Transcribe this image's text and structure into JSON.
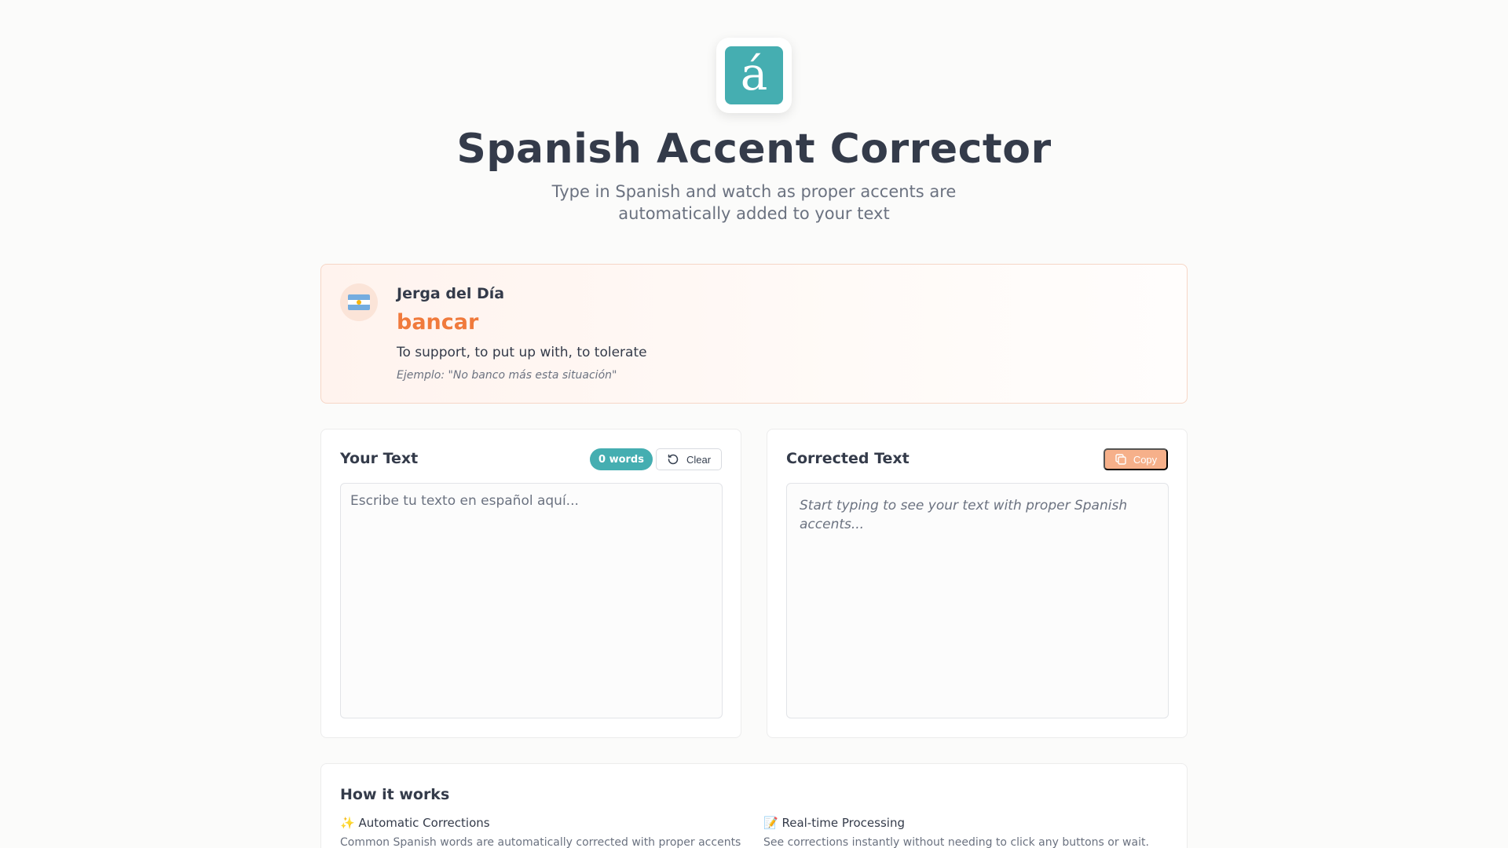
{
  "header": {
    "logo_letter": "á",
    "title": "Spanish Accent Corrector",
    "subtitle": "Type in Spanish and watch as proper accents are automatically added to your text"
  },
  "slang_card": {
    "flag_icon": "argentina-flag-icon",
    "label": "Jerga del Día",
    "word": "bancar",
    "definition": "To support, to put up with, to tolerate",
    "example": "Ejemplo: \"No banco más esta situación\""
  },
  "input_panel": {
    "title": "Your Text",
    "word_count": "0 words",
    "clear_label": "Clear",
    "value": "",
    "placeholder": "Escribe tu texto en español aquí..."
  },
  "output_panel": {
    "title": "Corrected Text",
    "copy_label": "Copy",
    "placeholder": "Start typing to see your text with proper Spanish accents..."
  },
  "how_it_works": {
    "title": "How it works",
    "items": [
      {
        "icon": "sparkles-icon",
        "emoji": "✨",
        "title": "Automatic Corrections",
        "description": "Common Spanish words are automatically corrected with proper accents"
      },
      {
        "icon": "memo-icon",
        "emoji": "📝",
        "title": "Real-time Processing",
        "description": "See corrections instantly without needing to click any buttons or wait."
      }
    ]
  },
  "colors": {
    "brand_teal": "#45aeb1",
    "slang_orange": "#f07a3c",
    "copy_button": "#f6b08a"
  }
}
